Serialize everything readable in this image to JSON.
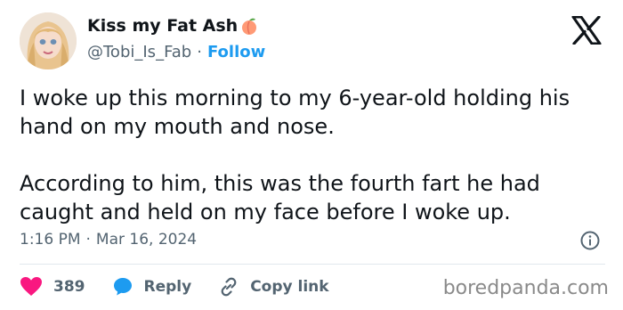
{
  "author": {
    "display_name": "Kiss my Fat Ash",
    "handle": "@Tobi_Is_Fab",
    "separator": "·",
    "follow_label": "Follow",
    "emoji_icon": "peach-icon"
  },
  "tweet": {
    "paragraphs": [
      "I woke up this morning to my 6-year-old holding his hand on my mouth and nose.",
      "According to him, this was the fourth fart he had caught and held on my face before I woke up."
    ],
    "time": "1:16 PM",
    "date_separator": "·",
    "date": "Mar 16, 2024"
  },
  "actions": {
    "like_count": "389",
    "reply_label": "Reply",
    "copy_label": "Copy link"
  },
  "watermark": "boredpanda.com",
  "colors": {
    "accent": "#1d9bf0",
    "like": "#f91880",
    "text": "#0f1419",
    "muted": "#536471"
  }
}
